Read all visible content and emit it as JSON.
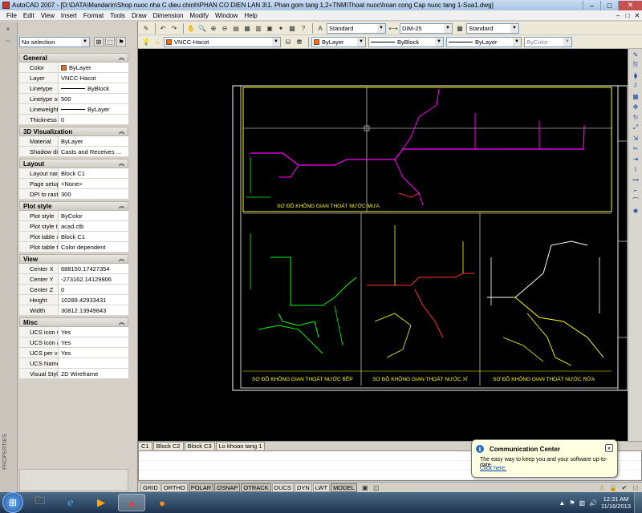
{
  "window": {
    "title": "AutoCAD 2007 - [D:\\DATA\\Mandarin\\Shop nuoc nha C dieu chinh\\PHAN CO DIEN LAN 3\\1. Phan gom tang 1,2+TNM\\Thoat nuoc\\hoan cong Cap nuoc tang 1-Sua1.dwg]",
    "minimize": "–",
    "maximize": "□",
    "close": "✕"
  },
  "menu": {
    "items": [
      "File",
      "Edit",
      "View",
      "Insert",
      "Format",
      "Tools",
      "Draw",
      "Dimension",
      "Modify",
      "Window",
      "Help"
    ],
    "mdi": [
      "–",
      "□",
      "✕"
    ]
  },
  "toolbar1": {
    "text_style": "Standard",
    "dim_style": "DIM-25",
    "table_style": "Standard"
  },
  "toolbar2": {
    "layer": "VNCC-Hacot",
    "color": "ByLayer",
    "linetype": "ByBlock",
    "lineweight": "ByLayer",
    "plotstyle": "ByColor"
  },
  "properties": {
    "selection": "No selection",
    "palette_label": "PROPERTIES",
    "sections": [
      {
        "name": "General",
        "rows": [
          {
            "label": "Color",
            "value": "ByLayer",
            "kind": "color"
          },
          {
            "label": "Layer",
            "value": "VNCC-Hacot"
          },
          {
            "label": "Linetype",
            "value": "ByBlock",
            "kind": "line"
          },
          {
            "label": "Linetype scale",
            "value": "500"
          },
          {
            "label": "Lineweight",
            "value": "ByLayer",
            "kind": "line"
          },
          {
            "label": "Thickness",
            "value": "0"
          }
        ]
      },
      {
        "name": "3D Visualization",
        "rows": [
          {
            "label": "Material",
            "value": "ByLayer"
          },
          {
            "label": "Shadow disp...",
            "value": "Casts and Receives ..."
          }
        ]
      },
      {
        "name": "Layout",
        "rows": [
          {
            "label": "Layout name",
            "value": "Block C1"
          },
          {
            "label": "Page setup ...",
            "value": "<None>"
          },
          {
            "label": "DPI to raster",
            "value": "300"
          }
        ]
      },
      {
        "name": "Plot style",
        "rows": [
          {
            "label": "Plot style",
            "value": "ByColor"
          },
          {
            "label": "Plot style ta...",
            "value": "acad.ctb"
          },
          {
            "label": "Plot table att...",
            "value": "Block C1"
          },
          {
            "label": "Plot table type",
            "value": "Color dependent"
          }
        ]
      },
      {
        "name": "View",
        "rows": [
          {
            "label": "Center X",
            "value": "688150.17427354"
          },
          {
            "label": "Center Y",
            "value": "-273162.14129806"
          },
          {
            "label": "Center Z",
            "value": "0"
          },
          {
            "label": "Height",
            "value": "10289.42933431"
          },
          {
            "label": "Width",
            "value": "30812.13949843"
          }
        ]
      },
      {
        "name": "Misc",
        "rows": [
          {
            "label": "UCS icon On",
            "value": "Yes"
          },
          {
            "label": "UCS icon at ...",
            "value": "Yes"
          },
          {
            "label": "UCS per vie...",
            "value": "Yes"
          },
          {
            "label": "UCS Name",
            "value": ""
          },
          {
            "label": "Visual Style",
            "value": "2D Wireframe"
          }
        ]
      }
    ]
  },
  "drawing": {
    "labels": [
      "SƠ ĐỒ KHÔNG GIAN THOÁT NƯỚC MƯA",
      "SƠ ĐỒ KHÔNG GIAN THOÁT NƯỚC BẾP",
      "SƠ ĐỒ KHÔNG GIAN THOÁT NƯỚC XÍ",
      "SƠ ĐỒ KHÔNG GIAN THOÁT NƯỚC RỬA"
    ]
  },
  "tabs": [
    "C1",
    "Block C2",
    "Block C3",
    "Lo khoan tang 1"
  ],
  "statusbar": {
    "buttons": [
      "GRID",
      "ORTHO",
      "POLAR",
      "OSNAP",
      "OTRACK",
      "DUCS",
      "DYN",
      "LWT",
      "MODEL"
    ],
    "on": [
      "POLAR",
      "OSNAP",
      "OTRACK",
      "MODEL"
    ]
  },
  "comm_center": {
    "title": "Communication Center",
    "body": "The easy way to keep you and your software up-to-date.",
    "link": "Click here."
  },
  "taskbar": {
    "time": "12:31 AM",
    "date": "11/16/2013"
  },
  "colors": {
    "canvas": "#000000",
    "frame": "#ffffff",
    "yellow": "#ffff00",
    "green": "#00ff00",
    "magenta": "#ff00ff",
    "red": "#ff3030"
  }
}
